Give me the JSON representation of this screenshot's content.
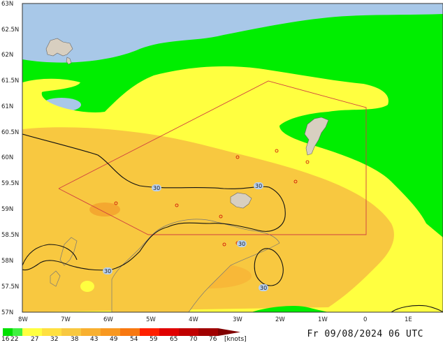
{
  "lat_labels": [
    "63N",
    "62.5N",
    "62N",
    "61.5N",
    "61N",
    "60.5N",
    "60N",
    "59.5N",
    "59N",
    "58.5N",
    "58N",
    "57.5N",
    "57N"
  ],
  "lon_labels": [
    "8W",
    "7W",
    "6W",
    "5W",
    "4W",
    "3W",
    "2W",
    "1W",
    "0",
    "1E"
  ],
  "contour_labels": [
    "30",
    "30",
    "30",
    "30",
    "30"
  ],
  "legend": {
    "ticks": [
      "16",
      "22",
      "27",
      "32",
      "38",
      "43",
      "49",
      "54",
      "59",
      "65",
      "70",
      "76"
    ],
    "unit": "[knots]",
    "colors": [
      "#00e000",
      "#20f020",
      "#ffff40",
      "#ffe040",
      "#f8c040",
      "#f8a830",
      "#f88800",
      "#ff3000",
      "#e00000",
      "#c00000",
      "#a00000",
      "#800000"
    ]
  },
  "valid_time": "Fr 09/08/2024 06 UTC"
}
